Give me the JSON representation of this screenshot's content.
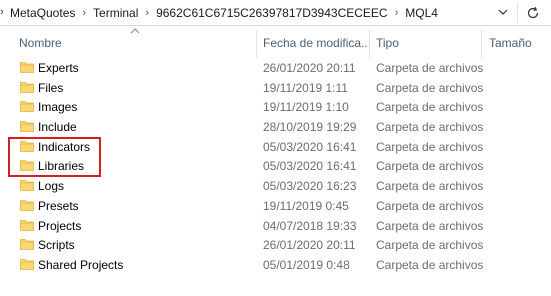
{
  "breadcrumb": {
    "items": [
      "MetaQuotes",
      "Terminal",
      "9662C61C6715C26397817D3943CECEEC",
      "MQL4"
    ]
  },
  "columns": {
    "name": "Nombre",
    "date": "Fecha de modifica...",
    "type": "Tipo",
    "size": "Tamaño"
  },
  "files": [
    {
      "name": "Experts",
      "date": "26/01/2020 20:11",
      "type": "Carpeta de archivos",
      "icon": "folder-icon"
    },
    {
      "name": "Files",
      "date": "19/11/2019 1:11",
      "type": "Carpeta de archivos",
      "icon": "folder-icon"
    },
    {
      "name": "Images",
      "date": "19/11/2019 1:10",
      "type": "Carpeta de archivos",
      "icon": "folder-icon"
    },
    {
      "name": "Include",
      "date": "28/10/2019 19:29",
      "type": "Carpeta de archivos",
      "icon": "folder-icon"
    },
    {
      "name": "Indicators",
      "date": "05/03/2020 16:41",
      "type": "Carpeta de archivos",
      "icon": "folder-icon"
    },
    {
      "name": "Libraries",
      "date": "05/03/2020 16:41",
      "type": "Carpeta de archivos",
      "icon": "folder-icon"
    },
    {
      "name": "Logs",
      "date": "05/03/2020 16:23",
      "type": "Carpeta de archivos",
      "icon": "folder-icon"
    },
    {
      "name": "Presets",
      "date": "19/11/2019 0:45",
      "type": "Carpeta de archivos",
      "icon": "folder-icon"
    },
    {
      "name": "Projects",
      "date": "04/07/2018 19:33",
      "type": "Carpeta de archivos",
      "icon": "folder-icon"
    },
    {
      "name": "Scripts",
      "date": "26/01/2020 20:11",
      "type": "Carpeta de archivos",
      "icon": "folder-icon"
    },
    {
      "name": "Shared Projects",
      "date": "05/01/2019 0:48",
      "type": "Carpeta de archivos",
      "icon": "folder-icon"
    }
  ],
  "colors": {
    "folder": "#f8d775",
    "folder_dark": "#e3b33a",
    "highlight": "#d21f1f",
    "header_text": "#4c607a",
    "meta_text": "#6d6d6d"
  }
}
